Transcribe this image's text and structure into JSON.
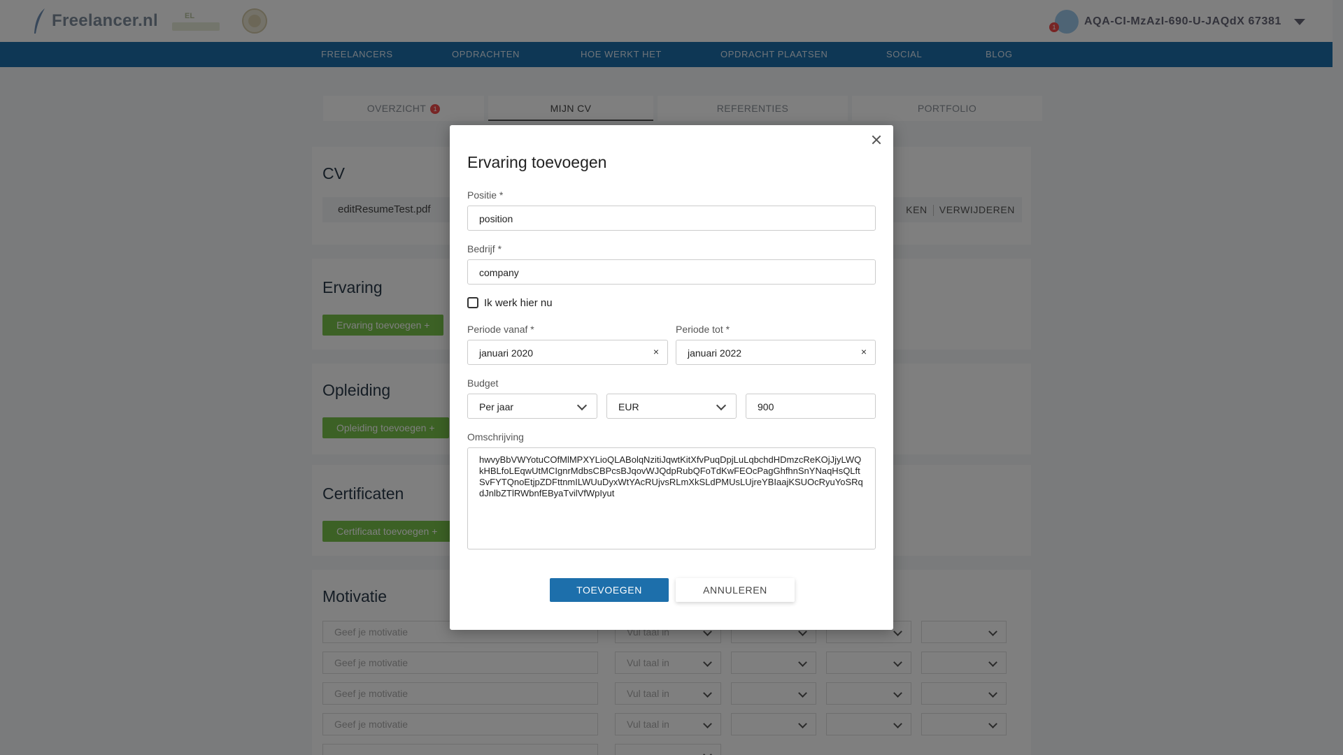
{
  "header": {
    "brand": "Freelancer.nl",
    "badge1_text": "EL",
    "username": "AQA-CI-MzAzI-690-U-JAQdX 67381",
    "notification_count": "1"
  },
  "nav": {
    "items": [
      "FREELANCERS",
      "OPDRACHTEN",
      "HOE WERKT HET",
      "OPDRACHT PLAATSEN",
      "SOCIAL",
      "BLOG"
    ]
  },
  "subtabs": {
    "overview": "OVERZICHT",
    "overview_badge": "1",
    "cv": "MIJN CV",
    "references": "REFERENTIES",
    "portfolio": "PORTFOLIO"
  },
  "cv_section": {
    "title": "CV",
    "filename": "editResumeTest.pdf",
    "action_partial": "KEN",
    "delete_label": "VERWIJDEREN"
  },
  "experience_section": {
    "title": "Ervaring",
    "add_button": "Ervaring toevoegen +"
  },
  "education_section": {
    "title": "Opleiding",
    "add_button": "Opleiding toevoegen +"
  },
  "certificates_section": {
    "title": "Certificaten",
    "add_button": "Certificaat toevoegen +"
  },
  "motivation_section": {
    "title": "Motivatie",
    "input_placeholder": "Geef je motivatie",
    "select_placeholder": "Vul taal in"
  },
  "modal": {
    "title": "Ervaring toevoegen",
    "position_label": "Positie *",
    "position_value": "position",
    "company_label": "Bedrijf *",
    "company_value": "company",
    "currently_working_label": "Ik werk hier nu",
    "period_from_label": "Periode vanaf *",
    "period_from_value": "januari 2020",
    "period_to_label": "Periode tot *",
    "period_to_value": "januari 2022",
    "clear_symbol": "×",
    "budget_label": "Budget",
    "budget_period": "Per jaar",
    "budget_currency": "EUR",
    "budget_amount": "900",
    "description_label": "Omschrijving",
    "description_value": "hwvyBbVWYotuCOfMlMPXYLioQLABolqNzitiJqwtKitXfvPuqDpjLuLqbchdHDmzcReKOjJjyLWQkHBLfoLEqwUtMCIgnrMdbsCBPcsBJqovWJQdpRubQFoTdKwFEOcPagGhfhnSnYNaqHsQLftSvFYTQnoEtjpZDFttnmILWUuDyxWtYAcRUjvsRLmXkSLdPMUsLUjreYBIaajKSUOcRyuYoSRqdJnlbZTlRWbnfEByaTvilVfWpIyut",
    "submit_label": "TOEVOEGEN",
    "cancel_label": "ANNULEREN"
  }
}
